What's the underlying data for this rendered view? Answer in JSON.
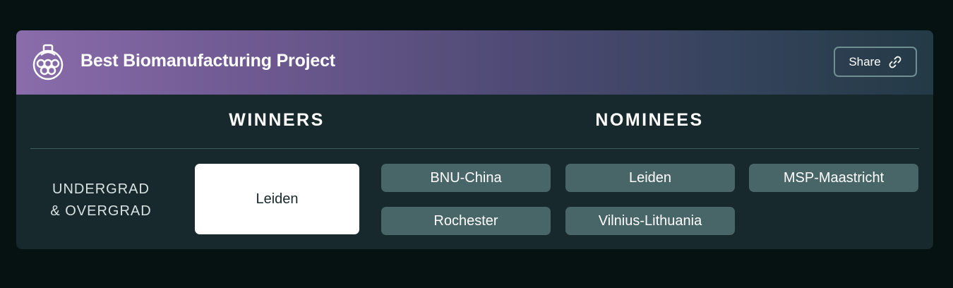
{
  "award": {
    "title": "Best Biomanufacturing Project",
    "icon": "bioreactor-icon",
    "share_label": "Share",
    "share_icon": "link-icon"
  },
  "columns": {
    "winners": "WINNERS",
    "nominees": "NOMINEES"
  },
  "category": {
    "line1": "UNDERGRAD",
    "line2": "& OVERGRAD",
    "winner": "Leiden",
    "nominees": [
      "BNU-China",
      "Leiden",
      "MSP-Maastricht",
      "Rochester",
      "Vilnius-Lithuania"
    ]
  },
  "colors": {
    "page_background": "#061112",
    "card_background": "#17292c",
    "header_gradient_start": "#8a6cab",
    "nominee_chip": "#486668",
    "winner_chip": "#ffffff"
  }
}
